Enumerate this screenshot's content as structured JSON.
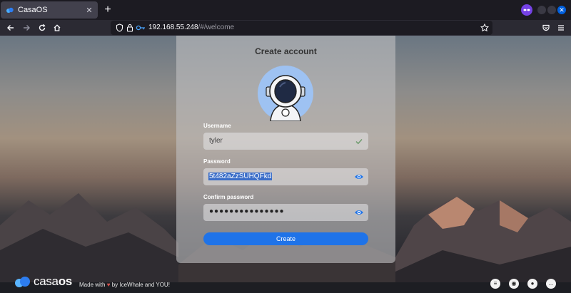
{
  "browser": {
    "tab_title": "CasaOS",
    "tab_close": "✕",
    "new_tab": "+",
    "url_host": "192.168.55.248",
    "url_path": "/#/welcome"
  },
  "card": {
    "title": "Create account",
    "username_label": "Username",
    "username_value": "tyler",
    "password_label": "Password",
    "password_value": "5t482aZzSUHQFkd",
    "confirm_label": "Confirm password",
    "confirm_value": "●●●●●●●●●●●●●●●",
    "create_label": "Create"
  },
  "footer": {
    "logo_casa": "casa",
    "logo_os": "os",
    "made_with": "Made with",
    "heart": "♥",
    "made_by": "by IceWhale and YOU!"
  },
  "colors": {
    "accent": "#1f73e8",
    "selection": "#3b6ec9"
  }
}
